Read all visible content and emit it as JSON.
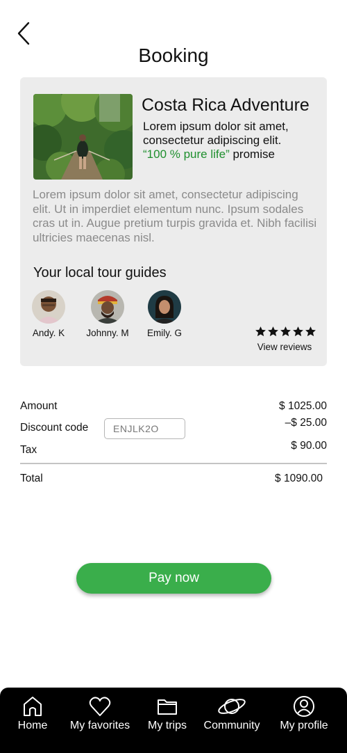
{
  "header": {
    "title": "Booking"
  },
  "tour": {
    "title": "Costa Rica Adventure",
    "subtitle_line": "Lorem ipsum dolor sit amet, consectetur adipiscing elit.",
    "promise_highlight": "“100 % pure life”",
    "promise_suffix": " promise",
    "description": "Lorem ipsum dolor sit amet, consectetur adipiscing elit. Ut in imperdiet elementum nunc. Ipsum sodales cras ut in. Augue pretium turpis gravida et. Nibh facilisi ultricies maecenas nisl.",
    "photo_icon": "jungle-bridge-photo"
  },
  "guides": {
    "heading": "Your local tour guides",
    "items": [
      {
        "name": "Andy. K"
      },
      {
        "name": "Johnny. M"
      },
      {
        "name": "Emily. G"
      }
    ],
    "rating": 5,
    "view_reviews": "View reviews"
  },
  "summary": {
    "amount_label": "Amount",
    "amount_value": "$ 1025.00",
    "discount_label": "Discount code",
    "discount_code": "ENJLK2O",
    "discount_value": "–$ 25.00",
    "tax_label": "Tax",
    "tax_value": "$ 90.00",
    "total_label": "Total",
    "total_value": "$ 1090.00"
  },
  "actions": {
    "pay_label": "Pay now",
    "accent_color": "#3aae4b"
  },
  "tabbar": {
    "items": [
      {
        "label": "Home",
        "icon": "home-icon"
      },
      {
        "label": "My favorites",
        "icon": "heart-icon"
      },
      {
        "label": "My trips",
        "icon": "folder-icon"
      },
      {
        "label": "Community",
        "icon": "planet-icon"
      },
      {
        "label": "My profile",
        "icon": "user-circle-icon"
      }
    ]
  }
}
